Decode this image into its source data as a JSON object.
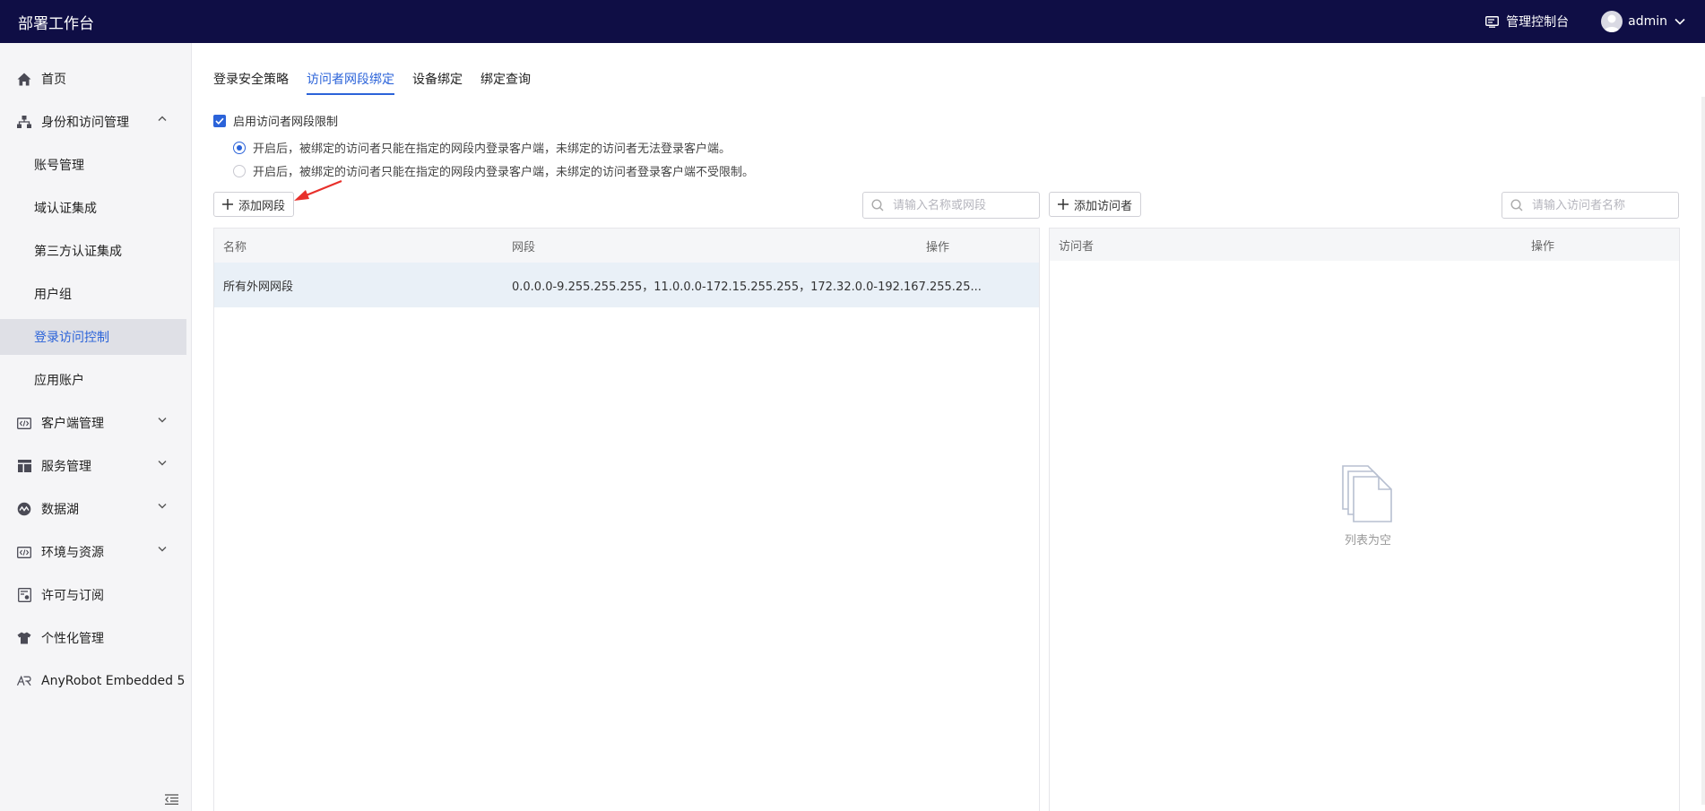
{
  "topbar": {
    "title": "部署工作台",
    "console_label": "管理控制台",
    "username": "admin"
  },
  "sidebar": {
    "items": [
      {
        "label": "首页",
        "icon": "home-icon"
      },
      {
        "label": "身份和访问管理",
        "icon": "org-tree-icon",
        "expanded": true
      },
      {
        "label": "账号管理"
      },
      {
        "label": "域认证集成"
      },
      {
        "label": "第三方认证集成"
      },
      {
        "label": "用户组"
      },
      {
        "label": "登录访问控制",
        "active": true
      },
      {
        "label": "应用账户"
      },
      {
        "label": "客户端管理",
        "icon": "code-window-icon"
      },
      {
        "label": "服务管理",
        "icon": "layout-icon"
      },
      {
        "label": "数据湖",
        "icon": "wave-icon"
      },
      {
        "label": "环境与资源",
        "icon": "code-window-icon"
      },
      {
        "label": "许可与订阅",
        "icon": "license-icon"
      },
      {
        "label": "个性化管理",
        "icon": "shirt-icon"
      },
      {
        "label": "AnyRobot Embedded 5",
        "icon": "anyrobot-icon"
      }
    ]
  },
  "tabs": [
    {
      "label": "登录安全策略"
    },
    {
      "label": "访问者网段绑定",
      "active": true
    },
    {
      "label": "设备绑定"
    },
    {
      "label": "绑定查询"
    }
  ],
  "restriction": {
    "enable_label": "启用访问者网段限制",
    "enabled": true,
    "option1": "开启后，被绑定的访问者只能在指定的网段内登录客户端，未绑定的访问者无法登录客户端。",
    "option2": "开启后，被绑定的访问者只能在指定的网段内登录客户端，未绑定的访问者登录客户端不受限制。",
    "selected_option": 1
  },
  "segments": {
    "add_button": "添加网段",
    "search_placeholder": "请输入名称或网段",
    "columns": {
      "name": "名称",
      "segment": "网段",
      "action": "操作"
    },
    "rows": [
      {
        "name": "所有外网网段",
        "segment": "0.0.0.0-9.255.255.255，11.0.0.0-172.15.255.255，172.32.0.0-192.167.255.25..."
      }
    ]
  },
  "visitors": {
    "add_button": "添加访问者",
    "search_placeholder": "请输入访问者名称",
    "columns": {
      "visitor": "访问者",
      "action": "操作"
    },
    "empty_text": "列表为空"
  },
  "colors": {
    "topbar": "#0f0e45",
    "accent": "#2b63d9",
    "sidebar_bg": "#f5f5f7",
    "selected_row": "#e9f0f7",
    "annotation_arrow": "#e8302b"
  }
}
